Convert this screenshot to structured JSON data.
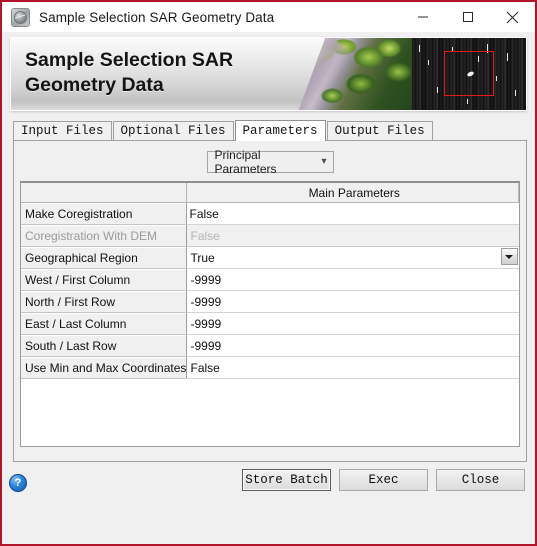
{
  "window": {
    "title": "Sample Selection SAR Geometry Data",
    "app_icon": "globe-icon",
    "controls": {
      "minimize": "minimize-icon",
      "maximize": "maximize-icon",
      "close": "close-icon"
    },
    "border_color": "#b0152b"
  },
  "banner": {
    "title": "Sample Selection SAR\nGeometry Data",
    "image_left": "optical-aerial-image",
    "image_right": "sar-image",
    "selection_box_color": "#e01b1b"
  },
  "tabs": [
    {
      "label": "Input Files",
      "active": false
    },
    {
      "label": "Optional Files",
      "active": false
    },
    {
      "label": "Parameters",
      "active": true
    },
    {
      "label": "Output Files",
      "active": false
    }
  ],
  "parameter_set": {
    "selected": "Principal Parameters",
    "chevron": "chevron-down-icon"
  },
  "table": {
    "headers": [
      "",
      "Main Parameters"
    ],
    "rows": [
      {
        "key": "Make Coregistration",
        "value": "False",
        "disabled": false,
        "focused": true,
        "dropdown": false
      },
      {
        "key": "Coregistration With DEM",
        "value": "False",
        "disabled": true,
        "focused": false,
        "dropdown": false
      },
      {
        "key": "Geographical Region",
        "value": "True",
        "disabled": false,
        "focused": false,
        "dropdown": true
      },
      {
        "key": "West / First Column",
        "value": "-9999",
        "disabled": false,
        "focused": false,
        "dropdown": false
      },
      {
        "key": "North / First Row",
        "value": "-9999",
        "disabled": false,
        "focused": false,
        "dropdown": false
      },
      {
        "key": "East / Last Column",
        "value": "-9999",
        "disabled": false,
        "focused": false,
        "dropdown": false
      },
      {
        "key": "South / Last Row",
        "value": "-9999",
        "disabled": false,
        "focused": false,
        "dropdown": false
      },
      {
        "key": "Use Min and Max Coordinates",
        "value": "False",
        "disabled": false,
        "focused": false,
        "dropdown": false
      }
    ]
  },
  "footer": {
    "help_icon": "help-icon",
    "help_glyph": "?",
    "buttons": [
      {
        "label": "Store Batch",
        "focused": true
      },
      {
        "label": "Exec",
        "focused": false
      },
      {
        "label": "Close",
        "focused": false
      }
    ]
  }
}
